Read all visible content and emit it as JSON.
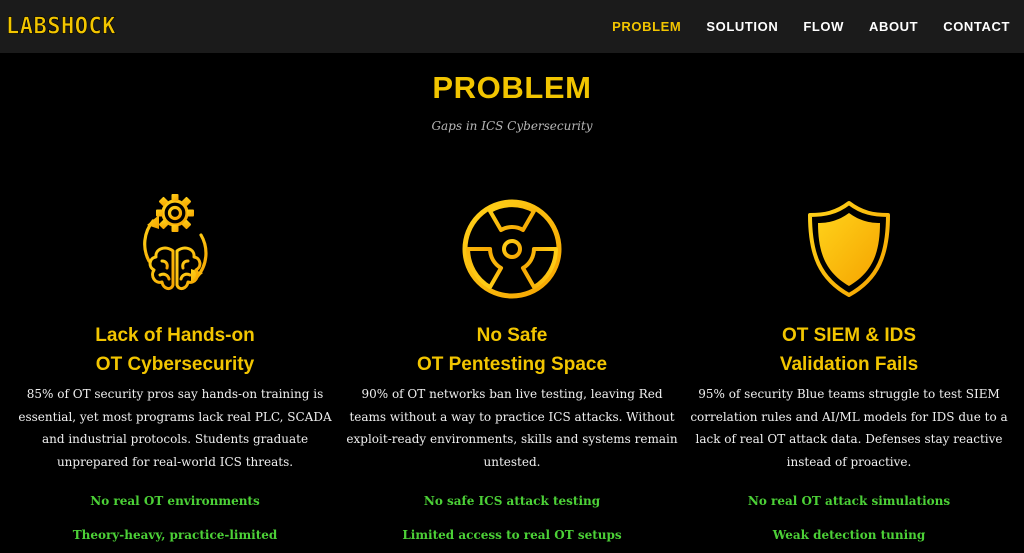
{
  "header": {
    "logo": "LABSHOCK",
    "nav": [
      {
        "label": "PROBLEM",
        "active": true
      },
      {
        "label": "SOLUTION",
        "active": false
      },
      {
        "label": "FLOW",
        "active": false
      },
      {
        "label": "ABOUT",
        "active": false
      },
      {
        "label": "CONTACT",
        "active": false
      }
    ]
  },
  "section": {
    "title": "PROBLEM",
    "subtitle": "Gaps in ICS Cybersecurity"
  },
  "cards": [
    {
      "icon": "gear-brain-cycle-icon",
      "title_line1": "Lack of Hands-on",
      "title_line2": "OT Cybersecurity",
      "description": "85% of OT security pros say hands-on training is essential, yet most programs lack real PLC, SCADA and industrial protocols. Students graduate unprepared for real-world ICS threats.",
      "tags": [
        "No real OT environments",
        "Theory-heavy, practice-limited"
      ]
    },
    {
      "icon": "radiation-icon",
      "title_line1": "No Safe",
      "title_line2": "OT Pentesting Space",
      "description": "90% of OT networks ban live testing, leaving Red teams without a way to practice ICS attacks. Without exploit-ready environments, skills and systems remain untested.",
      "tags": [
        "No safe ICS attack testing",
        "Limited access to real OT setups"
      ]
    },
    {
      "icon": "shield-icon",
      "title_line1": "OT SIEM & IDS",
      "title_line2": "Validation Fails",
      "description": "95% of security Blue teams struggle to test SIEM correlation rules and AI/ML models for IDS due to a lack of real OT attack data. Defenses stay reactive instead of proactive.",
      "tags": [
        "No real OT attack simulations",
        "Weak detection tuning"
      ]
    }
  ],
  "colors": {
    "accent": "#f2c500",
    "tag": "#4cd137",
    "background": "#000000",
    "navbar": "#1b1b1b"
  }
}
